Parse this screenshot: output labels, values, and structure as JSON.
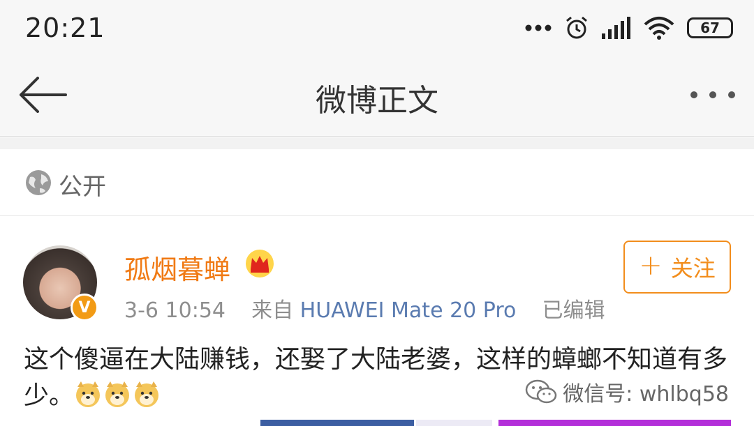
{
  "status_bar": {
    "time": "20:21",
    "battery": "67",
    "icons": [
      "more-dots-icon",
      "alarm-icon",
      "signal-icon",
      "wifi-icon",
      "battery-icon"
    ]
  },
  "nav": {
    "title": "微博正文",
    "back_icon": "back-arrow-icon",
    "more_icon": "more-icon"
  },
  "visibility": {
    "label": "公开",
    "icon": "globe-icon"
  },
  "post": {
    "username": "孤烟暮蝉",
    "badge_icon": "crown-icon",
    "verify_badge": "V",
    "time": "3-6 10:54",
    "source_prefix": "来自",
    "source": "HUAWEI Mate 20 Pro",
    "edited": "已编辑",
    "follow_label": "关注",
    "text": "这个傻逼在大陆赚钱，还娶了大陆老婆，这样的蟑螂不知道有多少。",
    "emojis": [
      "doge-icon",
      "doge-icon",
      "doge-icon"
    ]
  },
  "watermark": {
    "text": "微信号: whlbq58"
  },
  "colors": {
    "accent": "#f28d1c",
    "username": "#f07a14",
    "source_link": "#5a7bb0",
    "bar_bg": "#f7f7f7"
  }
}
